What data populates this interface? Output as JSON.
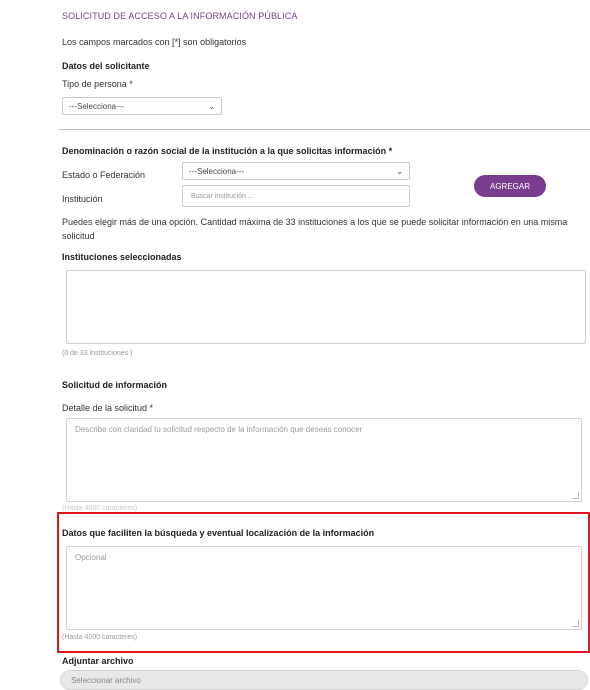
{
  "header": {
    "title": "SOLICITUD DE ACCESO A LA INFORMACIÓN PÚBLICA",
    "required_note": "Los campos marcados con [*] son obligatorios"
  },
  "solicitante": {
    "section_label": "Datos del solicitante",
    "tipo_label": "Tipo de persona *",
    "tipo_value": "---Selecciona---"
  },
  "institucion": {
    "section_label": "Denominación o razón social de la institución a la que solicitas información *",
    "estado_label": "Estado o Federación",
    "estado_value": "---Selecciona---",
    "institucion_label": "Institución",
    "institucion_placeholder": "Buscar institución ...",
    "add_button": "AGREGAR",
    "help_line1": "Puedes elegir más de una opción. Cantidad máxima de 33 instituciones a los que se puede solicitar información en una misma",
    "help_line2": "solicitud",
    "selected_label": "Instituciones seleccionadas",
    "selected_count": "(0 de 33 instituciones )"
  },
  "solicitud": {
    "section_label": "Solicitud de información",
    "detalle_label": "Detalle de la solicitud *",
    "detalle_placeholder": "Describe con claridad tu solicitud respecto de la información que deseas conocer",
    "detalle_limit": "(Hasta 4000 caracteres)"
  },
  "busqueda": {
    "section_label": "Datos que faciliten la búsqueda y eventual localización de la información",
    "placeholder": "Opcional",
    "limit": "(Hasta 4000 caracteres)"
  },
  "adjuntar": {
    "section_label": "Adjuntar archivo",
    "button": "Seleccionar archivo"
  },
  "colors": {
    "accent": "#7a3c8e",
    "highlight": "#e0141e"
  }
}
